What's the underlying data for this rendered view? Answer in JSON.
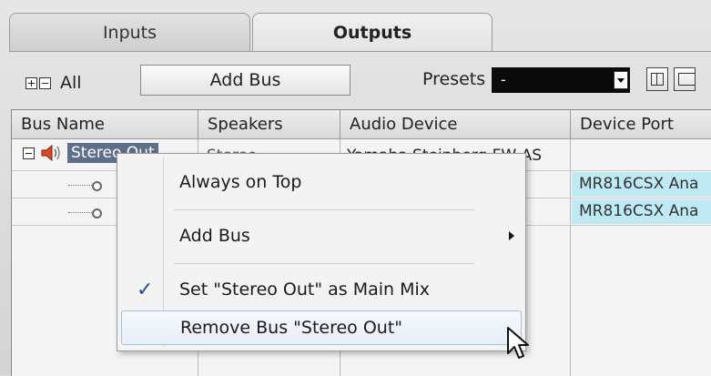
{
  "tabs": [
    {
      "label": "Inputs",
      "active": false
    },
    {
      "label": "Outputs",
      "active": true
    }
  ],
  "toolbar": {
    "all_label": "All",
    "add_bus_label": "Add Bus",
    "presets_label": "Presets",
    "presets_value": "-"
  },
  "table": {
    "columns": [
      "Bus Name",
      "Speakers",
      "Audio Device",
      "Device Port"
    ],
    "bus": {
      "name": "Stereo Out",
      "speakers": "Stereo",
      "audio_device": "Yamaha Steinberg FW AS",
      "ports": [
        "MR816CSX Ana",
        "MR816CSX Ana"
      ]
    }
  },
  "context_menu": {
    "items": [
      {
        "label": "Always on Top"
      },
      {
        "label": "Add Bus",
        "has_submenu": true
      },
      {
        "label": "Set \"Stereo Out\" as Main Mix",
        "checked": true
      },
      {
        "label": "Remove Bus \"Stereo Out\"",
        "hovered": true
      }
    ]
  },
  "colors": {
    "selection": "#5d6f8a",
    "port_cell": "#bfe9f3",
    "presets_bg": "#0a0a0a"
  }
}
